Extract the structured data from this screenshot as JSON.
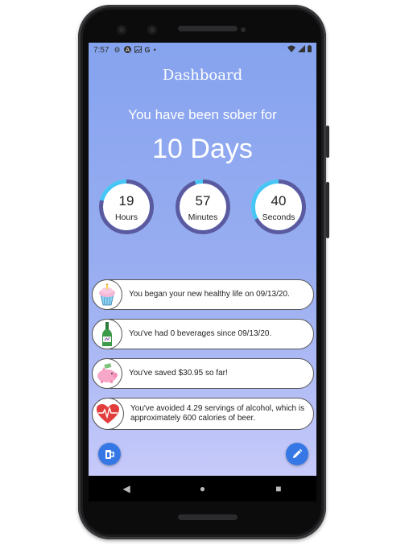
{
  "status_bar": {
    "time": "7:57",
    "left_icons": [
      "gear-icon",
      "a-icon",
      "image-icon",
      "g-icon",
      "dot-icon"
    ],
    "right_icons": [
      "wifi-icon",
      "signal-icon",
      "battery-icon"
    ]
  },
  "app_bar": {
    "title": "Dashboard"
  },
  "sober": {
    "subtitle": "You have been sober for",
    "days_label": "10 Days"
  },
  "timers": [
    {
      "value": "19",
      "unit": "Hours",
      "progress": 0.79
    },
    {
      "value": "57",
      "unit": "Minutes",
      "progress": 0.95
    },
    {
      "value": "40",
      "unit": "Seconds",
      "progress": 0.67
    }
  ],
  "cards": [
    {
      "icon": "cupcake-icon",
      "text": "You began your new healthy life on 09/13/20."
    },
    {
      "icon": "bottle-icon",
      "text": "You've had 0 beverages since 09/13/20."
    },
    {
      "icon": "piggy-bank-icon",
      "text": "You've saved $30.95 so far!"
    },
    {
      "icon": "heart-icon",
      "text": "You've avoided 4.29 servings of alcohol, which is approximately 600 calories of beer."
    }
  ],
  "fabs": {
    "left_icon": "drink-icon",
    "right_icon": "pencil-icon"
  },
  "nav": {
    "back": "◀",
    "home": "●",
    "recents": "■"
  },
  "colors": {
    "ring_track": "#45c6f5",
    "ring_progress": "#5b5aa0",
    "fab": "#3578e5",
    "screen_top": "#86a3ef",
    "screen_bottom": "#c7cafa"
  }
}
